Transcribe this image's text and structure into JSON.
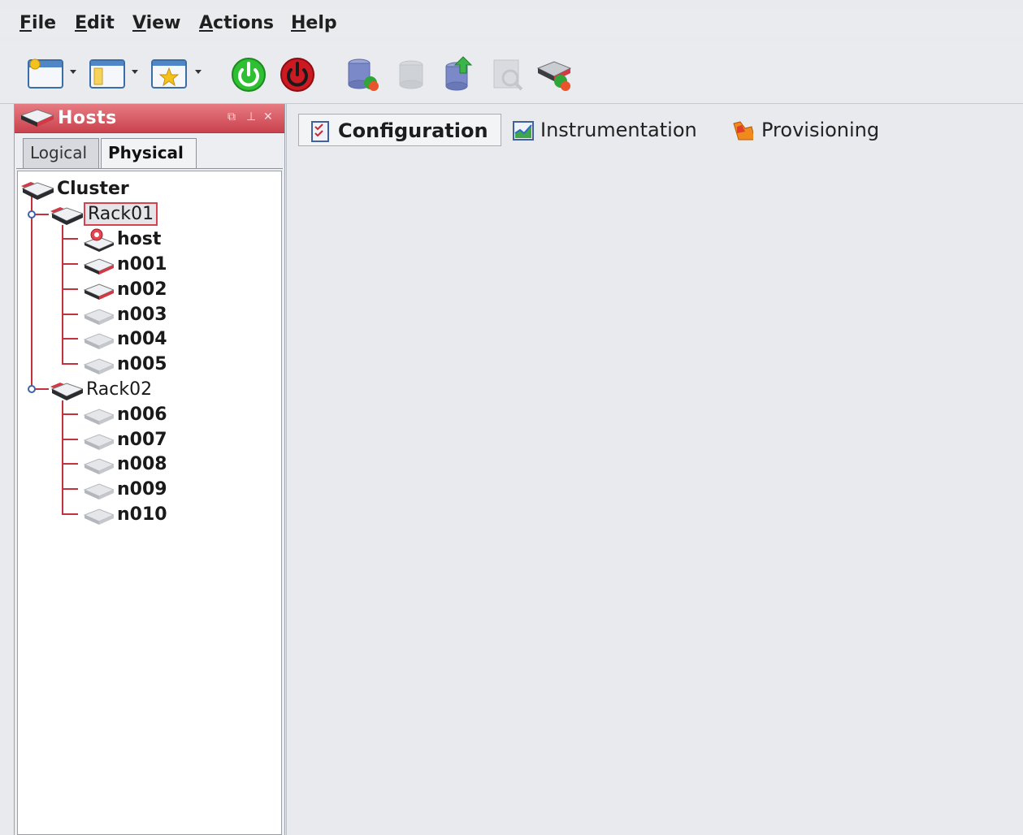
{
  "menu": {
    "items": [
      "File",
      "Edit",
      "View",
      "Actions",
      "Help"
    ]
  },
  "toolbar": {
    "buttons": [
      {
        "icon": "new-window-icon",
        "dropdown": true
      },
      {
        "icon": "layout-panel-icon",
        "dropdown": true
      },
      {
        "icon": "favorites-icon",
        "dropdown": true
      },
      {
        "icon": "power-on-icon"
      },
      {
        "icon": "power-off-icon"
      },
      {
        "icon": "database-refresh-icon"
      },
      {
        "icon": "database-disabled-icon"
      },
      {
        "icon": "database-upload-icon"
      },
      {
        "icon": "inspect-disabled-icon"
      },
      {
        "icon": "host-provision-icon"
      }
    ]
  },
  "hosts_panel": {
    "title": "Hosts",
    "tabs": {
      "logical": "Logical",
      "physical": "Physical"
    },
    "selected_tab": "Physical",
    "tree": {
      "root": "Cluster",
      "rack01": "Rack01",
      "rack01_children": [
        "host",
        "n001",
        "n002",
        "n003",
        "n004",
        "n005"
      ],
      "rack02": "Rack02",
      "rack02_children": [
        "n006",
        "n007",
        "n008",
        "n009",
        "n010"
      ],
      "selected": "Rack01"
    }
  },
  "content": {
    "tabs": {
      "configuration": "Configuration",
      "instrumentation": "Instrumentation",
      "provisioning": "Provisioning"
    },
    "active_tab": "Configuration"
  },
  "colors": {
    "accent": "#c9424d",
    "tree_line": "#c5303e",
    "power_on": "#27b32a",
    "power_off": "#c4141b"
  }
}
